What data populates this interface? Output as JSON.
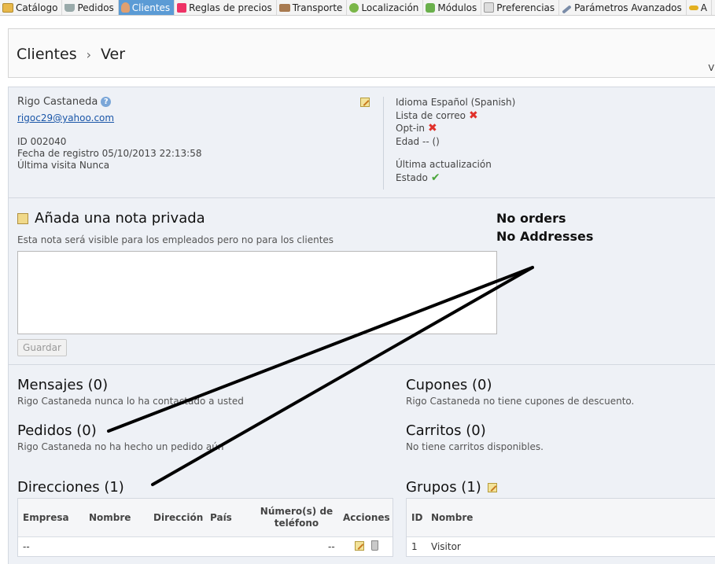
{
  "nav": {
    "tabs": [
      {
        "label": "Catálogo",
        "icon": "folder-icon"
      },
      {
        "label": "Pedidos",
        "icon": "cart-icon"
      },
      {
        "label": "Clientes",
        "icon": "customer-icon"
      },
      {
        "label": "Reglas de precios",
        "icon": "price-tag-icon"
      },
      {
        "label": "Transporte",
        "icon": "truck-icon"
      },
      {
        "label": "Localización",
        "icon": "globe-icon"
      },
      {
        "label": "Módulos",
        "icon": "puzzle-icon"
      },
      {
        "label": "Preferencias",
        "icon": "preferences-icon"
      },
      {
        "label": "Parámetros Avanzados",
        "icon": "wrench-icon"
      },
      {
        "label": "A",
        "icon": "key-icon"
      }
    ],
    "active_tab": "Clientes"
  },
  "header": {
    "breadcrumb_parent": "Clientes",
    "breadcrumb_separator": "›",
    "breadcrumb_current": "Ver",
    "right_fragment": "V"
  },
  "customer": {
    "name": "Rigo Castaneda",
    "email": "rigoc29@yahoo.com",
    "id_line": "ID 002040",
    "registered_line": "Fecha de registro 05/10/2013 22:13:58",
    "last_visit_line": "Última visita Nunca",
    "language_line": "Idioma Español (Spanish)",
    "newsletter_label": "Lista de correo",
    "optin_label": "Opt-in",
    "age_line": "Edad -- ()",
    "last_update_label": "Última actualización",
    "status_label": "Estado"
  },
  "note": {
    "title": "Añada una nota privada",
    "subtitle": "Esta nota será visible para los empleados pero no para los clientes",
    "value": "",
    "save_label": "Guardar"
  },
  "annotations": {
    "no_orders": "No orders",
    "no_addresses": "No Addresses"
  },
  "messages": {
    "title": "Mensajes (0)",
    "subtitle": "Rigo Castaneda nunca lo ha contactado a usted"
  },
  "orders": {
    "title": "Pedidos (0)",
    "subtitle": "Rigo Castaneda no ha hecho un pedido aún"
  },
  "vouchers": {
    "title": "Cupones (0)",
    "subtitle": "Rigo Castaneda no tiene cupones de descuento."
  },
  "carts": {
    "title": "Carritos (0)",
    "subtitle": "No tiene carritos disponibles."
  },
  "addresses": {
    "title": "Direcciones (1)",
    "columns": {
      "company": "Empresa",
      "name": "Nombre",
      "address": "Dirección",
      "country": "País",
      "phone_line1": "Número(s) de",
      "phone_line2": "teléfono",
      "actions": "Acciones"
    },
    "row": {
      "company": "--",
      "phone": "--"
    }
  },
  "groups": {
    "title": "Grupos (1)",
    "columns": {
      "id": "ID",
      "name": "Nombre"
    },
    "row": {
      "id": "1",
      "name": "Visitor"
    }
  },
  "colors": {
    "active_tab": "#5b9bd5",
    "panel_bg": "#eef1f6",
    "link": "#1a56a8",
    "cross": "#e0302a",
    "check": "#4aa53a",
    "annotation_stroke": "#000000"
  }
}
